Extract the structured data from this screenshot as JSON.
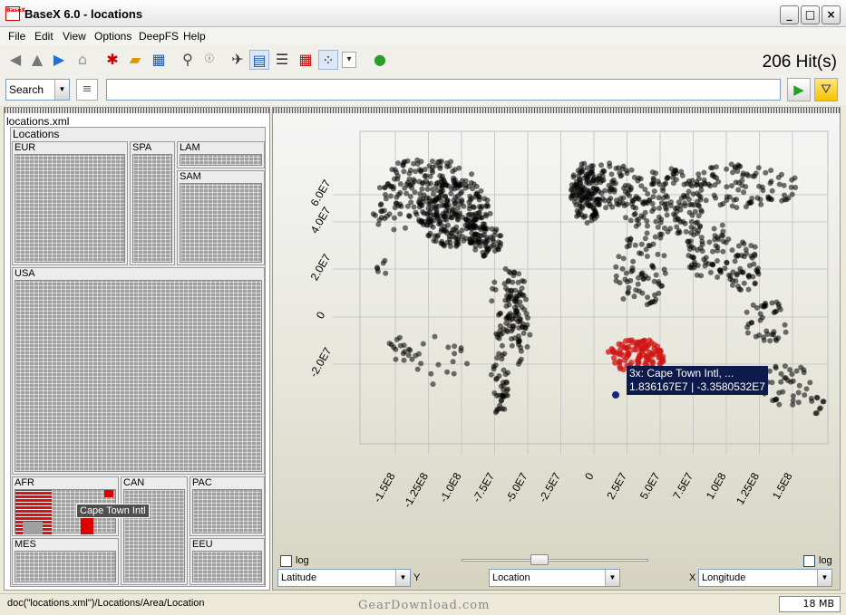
{
  "window": {
    "title": "BaseX 6.0 - locations",
    "app_icon_text": "BaseX"
  },
  "window_controls": {
    "minimize": "_",
    "maximize": "□",
    "close": "×"
  },
  "menu": [
    "File",
    "Edit",
    "View",
    "Options",
    "DeepFS",
    "Help"
  ],
  "toolbar": {
    "icons": [
      "back-icon",
      "up-icon",
      "forward-icon",
      "home-icon",
      "new-db-icon",
      "open-icon",
      "table-view-icon",
      "search-icon",
      "info-icon",
      "map-icon",
      "treemap-icon",
      "tree-icon",
      "table-icon",
      "scatter-icon",
      "dropdown-icon",
      "help-icon"
    ],
    "hits": "206 Hit(s)"
  },
  "search": {
    "mode": "Search",
    "query": ""
  },
  "treemap": {
    "root": "locations.xml",
    "child": "Locations",
    "regions": [
      "EUR",
      "SPA",
      "LAM",
      "SAM",
      "USA",
      "AFR",
      "CAN",
      "PAC",
      "MES",
      "EEU"
    ],
    "tooltip": "Cape Town Intl"
  },
  "plot": {
    "y_ticks": [
      "6.0E7",
      "4.0E7",
      "2.0E7",
      "0",
      "-2.0E7"
    ],
    "x_ticks": [
      "-1.5E8",
      "-1.25E8",
      "-1.0E8",
      "-7.5E7",
      "-5.0E7",
      "-2.5E7",
      "0",
      "2.5E7",
      "5.0E7",
      "7.5E7",
      "1.0E8",
      "1.25E8",
      "1.5E8"
    ],
    "tooltip_line1": "3x: Cape Town Intl, ...",
    "tooltip_line2": "1.836167E7 | -3.3580532E7",
    "log_label_left": "log",
    "log_label_right": "log",
    "y_select": "Latitude",
    "y_axis_letter": "Y",
    "item_select": "Location",
    "x_axis_letter": "X",
    "x_select": "Longitude"
  },
  "status": {
    "path": "doc(\"locations.xml\")/Locations/Area/Location",
    "memory": "18 MB"
  },
  "watermark": "GearDownload.com"
}
